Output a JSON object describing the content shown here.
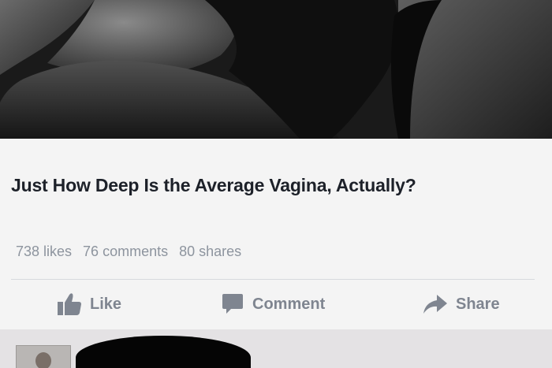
{
  "post": {
    "headline": "Just How Deep Is the Average Vagina, Actually?",
    "counts": {
      "likes": "738 likes",
      "comments": "76 comments",
      "shares": "80 shares"
    },
    "actions": {
      "like_label": "Like",
      "comment_label": "Comment",
      "share_label": "Share"
    }
  },
  "icons": {
    "like": "thumbs-up-icon",
    "comment": "speech-bubble-icon",
    "share": "share-arrow-icon"
  },
  "colors": {
    "headline": "#1d2129",
    "meta_text": "#8d949e",
    "action_text": "#7f8590",
    "background": "#f4f4f4",
    "redaction": "#050505"
  }
}
